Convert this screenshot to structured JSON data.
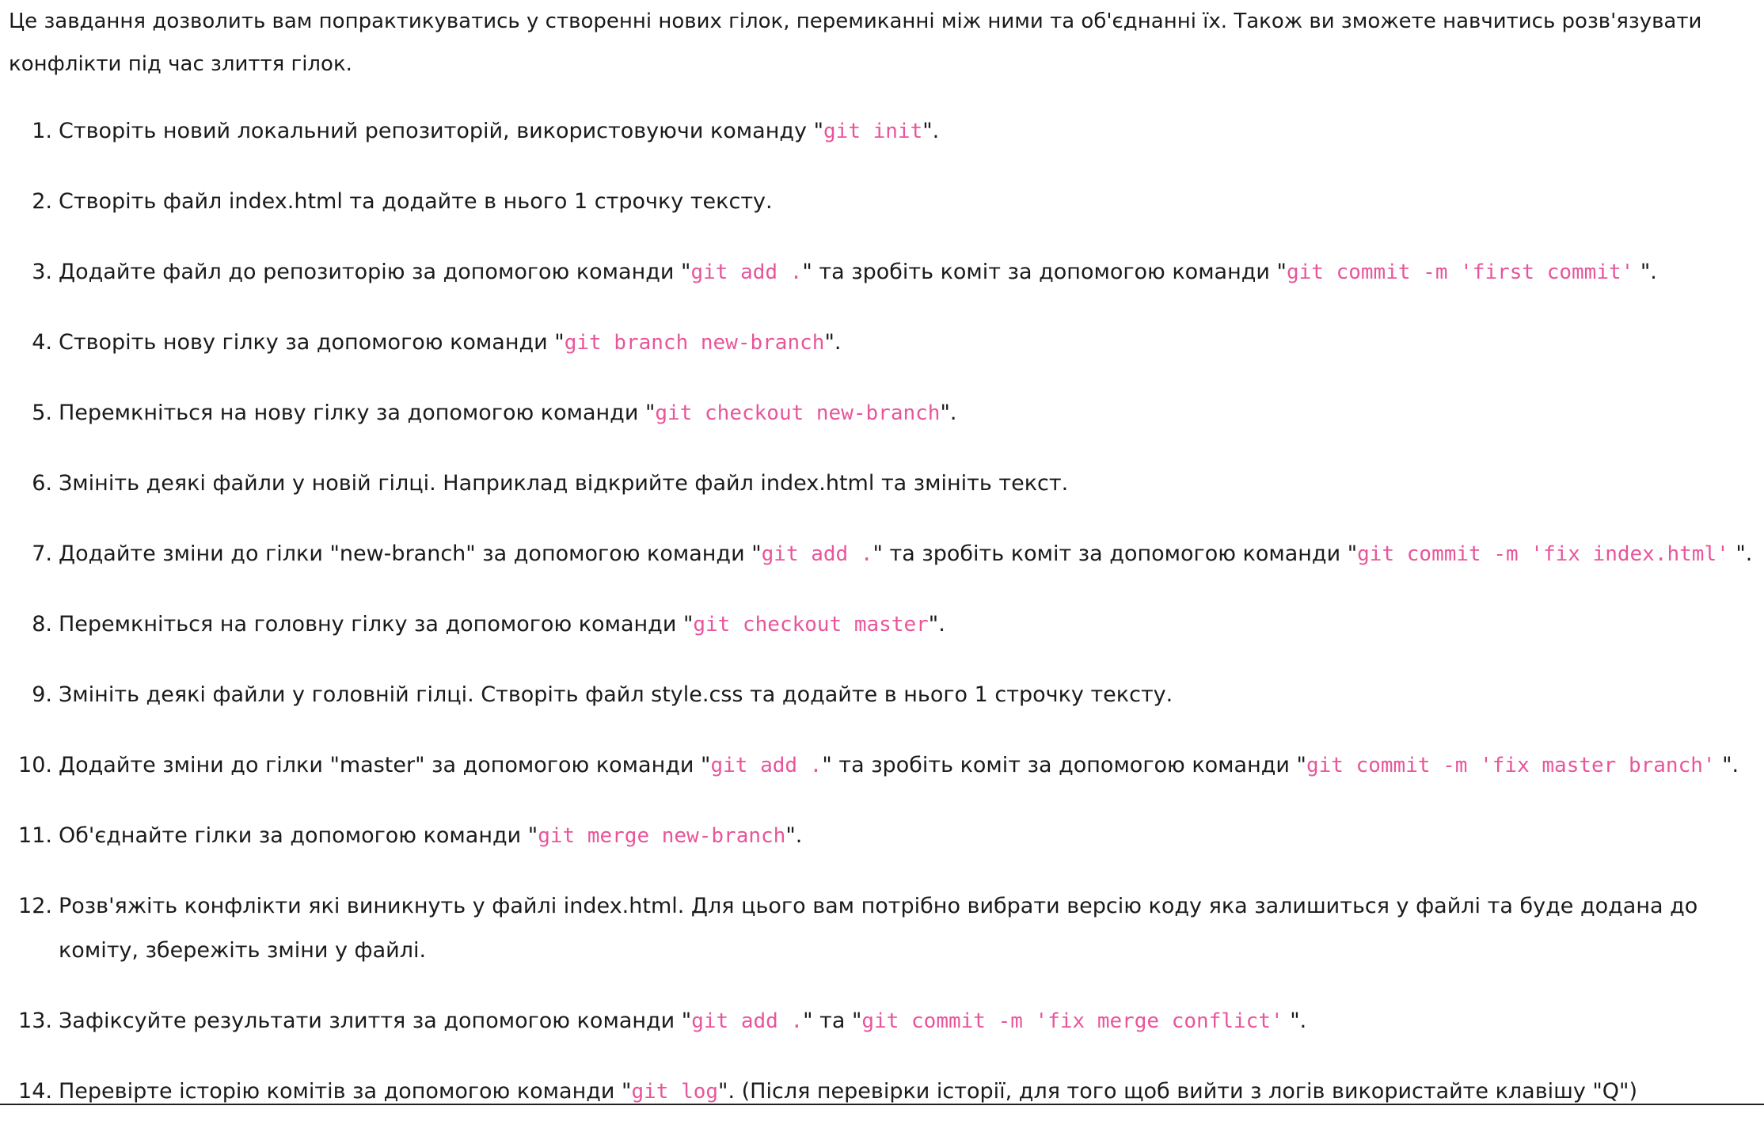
{
  "intro": "Це завдання дозволить вам попрактикуватись у створенні нових гілок, перемиканні між ними та об'єднанні їх. Також ви зможете навчитись розв'язувати конфлікти під час злиття гілок.",
  "steps": [
    {
      "num": "1.",
      "t1": "Створіть новий локальний репозиторій, використовуючи команду \"",
      "c1": "git init",
      "t2": "\"."
    },
    {
      "num": "2.",
      "t1": "Створіть файл index.html та додайте в нього 1 строчку тексту."
    },
    {
      "num": "3.",
      "t1": "Додайте файл до репозиторію за допомогою команди \"",
      "c1": "git add .",
      "t2": "\" та зробіть коміт за допомогою команди \"",
      "c2": "git commit -m 'first commit'",
      "t3": " \"."
    },
    {
      "num": "4.",
      "t1": "Створіть нову гілку за допомогою команди \"",
      "c1": "git branch new-branch",
      "t2": "\"."
    },
    {
      "num": "5.",
      "t1": "Перемкніться на нову гілку за допомогою команди \"",
      "c1": "git checkout new-branch",
      "t2": "\"."
    },
    {
      "num": "6.",
      "t1": "Змініть деякі файли у новій гілці. Наприклад відкрийте файл index.html та змініть текст."
    },
    {
      "num": "7.",
      "t1": "Додайте зміни до гілки \"new-branch\" за допомогою команди \"",
      "c1": "git add .",
      "t2": "\" та зробіть коміт за допомогою команди \"",
      "c2": "git commit -m 'fix index.html'",
      "t3": " \"."
    },
    {
      "num": "8.",
      "t1": "Перемкніться на головну гілку за допомогою команди \"",
      "c1": "git checkout master",
      "t2": "\"."
    },
    {
      "num": "9.",
      "t1": "Змініть деякі файли у головній гілці. Створіть файл style.css та додайте в нього 1 строчку тексту."
    },
    {
      "num": "10.",
      "t1": "Додайте зміни до гілки \"master\" за допомогою команди \"",
      "c1": "git add .",
      "t2": "\" та зробіть коміт за допомогою команди \"",
      "c2": "git commit -m 'fix master branch'",
      "t3": " \"."
    },
    {
      "num": "11.",
      "t1": "Об'єднайте гілки за допомогою команди \"",
      "c1": "git merge new-branch",
      "t2": "\"."
    },
    {
      "num": "12.",
      "t1": "Розв'яжіть конфлікти які виникнуть у файлі index.html. Для цього вам потрібно вибрати версію коду яка залишиться у файлі та буде додана до коміту, збережіть зміни у файлі."
    },
    {
      "num": "13.",
      "t1": "Зафіксуйте результати злиття за допомогою команди \"",
      "c1": "git add .",
      "t2": "\" та \"",
      "c2": "git commit -m 'fix merge conflict'",
      "t3": " \"."
    },
    {
      "num": "14.",
      "t1": "Перевірте історію комітів за допомогою команди \"",
      "c1": "git log",
      "t2": "\". (Після перевірки історії, для того щоб вийти з логів використайте клавішу \"Q\")"
    }
  ]
}
